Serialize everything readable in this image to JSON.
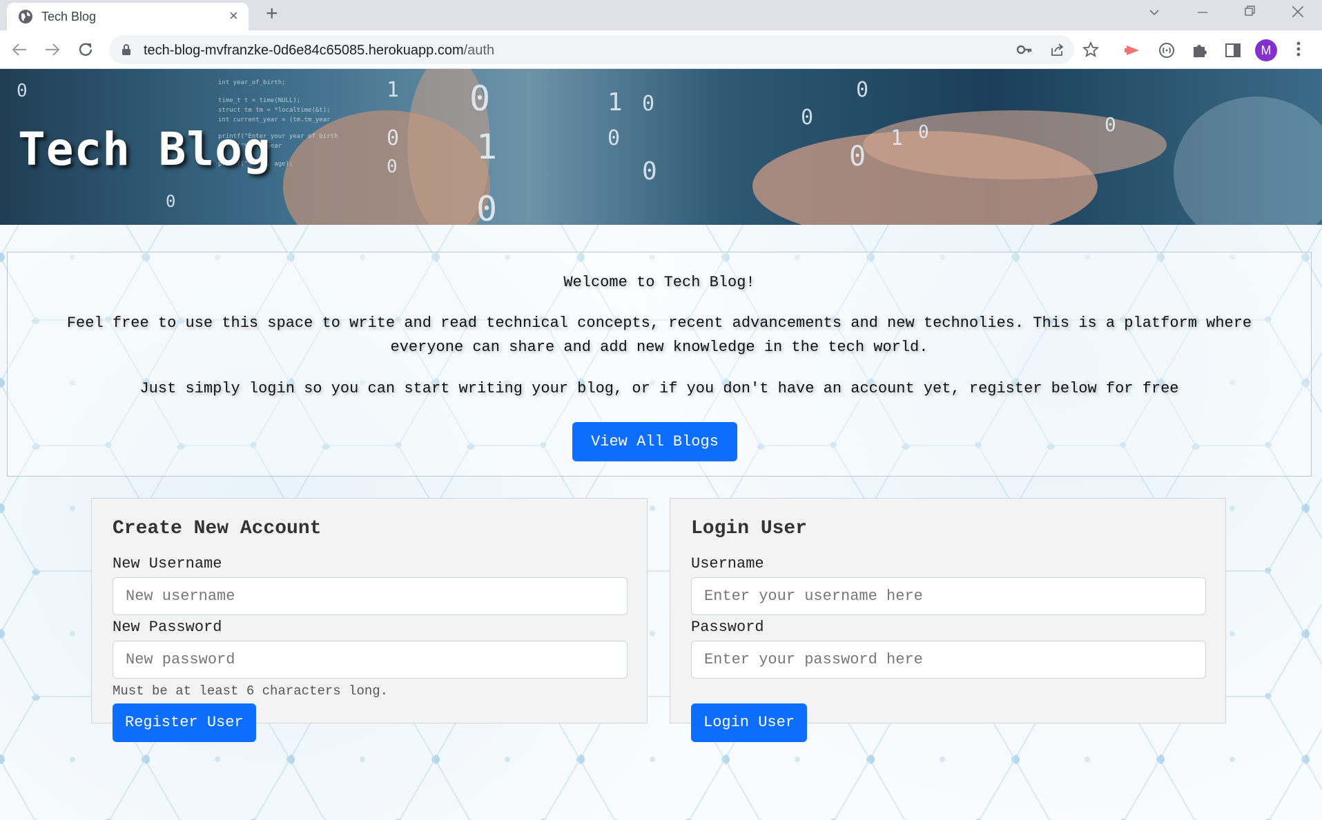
{
  "browser": {
    "tab_title": "Tech Blog",
    "tab_close": "×",
    "new_tab": "+",
    "url_host": "tech-blog-mvfranzke-0d6e84c65085.herokuapp.com",
    "url_path": "/auth",
    "profile_initial": "M",
    "icons": [
      "globe-icon",
      "back-icon",
      "forward-icon",
      "reload-icon",
      "lock-icon",
      "key-icon",
      "share-icon",
      "star-icon",
      "extension-red-icon",
      "extension-circle-icon",
      "puzzle-icon",
      "sidebar-icon",
      "kebab-menu-icon",
      "chevron-down-icon",
      "minimize-icon",
      "restore-icon",
      "close-window-icon"
    ]
  },
  "header": {
    "title": "Tech Blog"
  },
  "welcome": {
    "heading": "Welcome to Tech Blog!",
    "line1": "Feel free to use this space to write and read technical concepts, recent advancements and new technolies. This is a platform where",
    "line2": "everyone can share and add new knowledge in the tech world.",
    "line3": "Just simply login so you can start writing your blog, or if you don't have an account yet, register below for free",
    "button": "View All Blogs"
  },
  "signup": {
    "title": "Create New Account",
    "username_label": "New Username",
    "username_placeholder": "New username",
    "password_label": "New Password",
    "password_placeholder": "New password",
    "hint": "Must be at least 6 characters long.",
    "button": "Register User"
  },
  "login": {
    "title": "Login User",
    "username_label": "Username",
    "username_placeholder": "Enter your username here",
    "password_label": "Password",
    "password_placeholder": "Enter your password here",
    "button": "Login User"
  },
  "colors": {
    "primary_button": "#0d6efd",
    "card_background": "#f3f3f3",
    "tabstrip": "#dee1e6"
  }
}
